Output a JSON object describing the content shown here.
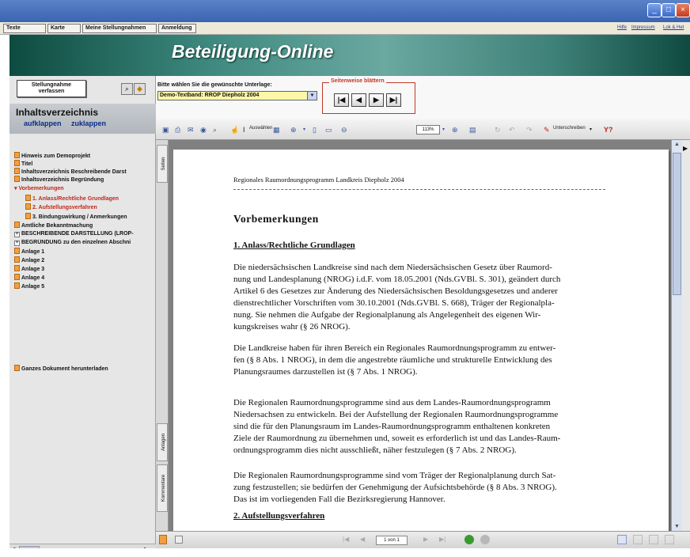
{
  "window_controls": [
    "_",
    "□",
    "×"
  ],
  "menu": {
    "items": [
      "Texte",
      "Karte",
      "Meine Stellungnahmen",
      "Anmeldung"
    ]
  },
  "top_links": [
    "Hilfe",
    "Impressum",
    "Lok & Het"
  ],
  "banner": {
    "title": "Beteiligung-Online"
  },
  "left": {
    "stellungnahme_button": "Stellungnahme\nverfassen",
    "icons": [
      "binoculars-icon",
      "arrow-icon"
    ],
    "inhalt_title": "Inhaltsverzeichnis",
    "aufklappen": "aufklappen",
    "zuklappen": "zuklappen",
    "tree": [
      {
        "label": "Hinweis zum Demoprojekt",
        "icon": "doc",
        "red": false
      },
      {
        "label": "Titel",
        "icon": "doc",
        "red": false
      },
      {
        "label": "Inhaltsverzeichnis Beschreibende Darst",
        "icon": "doc",
        "red": false
      },
      {
        "label": "Inhaltsverzeichnis Begründung",
        "icon": "doc",
        "red": false
      },
      {
        "label": "Vorbemerkungen",
        "icon": "bullet",
        "red": true
      },
      {
        "label": "1. Anlass/Rechtliche Grundlagen",
        "icon": "doc",
        "red": true,
        "indent": true
      },
      {
        "label": "2. Aufstellungsverfahren",
        "icon": "doc",
        "red": true,
        "indent": true
      },
      {
        "label": "3. Bindungswirkung / Anmerkungen",
        "icon": "doc",
        "red": false,
        "indent": true
      },
      {
        "label": "Amtliche Bekanntmachung",
        "icon": "doc",
        "red": false
      },
      {
        "label": "BESCHREIBENDE DARSTELLUNG (LROP-",
        "icon": "plus",
        "red": false
      },
      {
        "label": "BEGRÜNDUNG zu den einzelnen Abschni",
        "icon": "plus",
        "red": false
      },
      {
        "label": "Anlage 1",
        "icon": "doc",
        "red": false
      },
      {
        "label": "Anlage 2",
        "icon": "doc",
        "red": false
      },
      {
        "label": "Anlage 3",
        "icon": "doc",
        "red": false
      },
      {
        "label": "Anlage 4",
        "icon": "doc",
        "red": false
      },
      {
        "label": "Anlage 5",
        "icon": "doc",
        "red": false
      }
    ],
    "download": "Ganzes Dokument herunterladen"
  },
  "selector": {
    "label": "Bitte wählen Sie die gewünschte Unterlage:",
    "value": "Demo-Textband: RROP Diepholz 2004",
    "page_nav_label": "Seitenweise blättern",
    "nav_buttons": [
      "|◀",
      "◀",
      "▶",
      "▶|"
    ]
  },
  "pdf_toolbar": {
    "select_label": "Auswählen",
    "zoom": "113%",
    "sign_label": "Unterschreiben"
  },
  "side_tabs": [
    "Seiten",
    "Anlagen",
    "Kommentare"
  ],
  "document": {
    "header": "Regionales Raumordnungsprogramm Landkreis Diepholz 2004",
    "heading": "Vorbemerkungen",
    "section1": "1. Anlass/Rechtliche Grundlagen",
    "p1": [
      "Die niedersächsischen Landkreise sind nach dem Niedersächsischen Gesetz über Raumord-",
      "nung und Landesplanung (NROG) i.d.F. vom 18.05.2001 (Nds.GVBl. S. 301), geändert durch",
      "Artikel 6 des Gesetzes zur Änderung des Niedersächsischen Besoldungsgesetzes und anderer",
      "dienstrechtlicher Vorschriften vom 30.10.2001 (Nds.GVBl. S. 668), Träger der Regionalpla-",
      "nung. Sie nehmen die Aufgabe der Regionalplanung als Angelegenheit des eigenen Wir-",
      "kungskreises wahr (§ 26 NROG)."
    ],
    "p2": [
      "Die Landkreise haben für ihren Bereich ein Regionales Raumordnungsprogramm zu entwer-",
      "fen (§ 8 Abs. 1 NROG), in dem die angestrebte räumliche und strukturelle Entwicklung des",
      "Planungsraumes darzustellen ist (§ 7 Abs. 1 NROG)."
    ],
    "p3": [
      "Die Regionalen Raumordnungsprogramme sind aus dem Landes-Raumordnungsprogramm",
      "Niedersachsen zu entwickeln. Bei der Aufstellung der Regionalen Raumordnungsprogramme",
      "sind die für den Planungsraum im Landes-Raumordnungsprogramm enthaltenen konkreten",
      "Ziele der Raumordnung zu übernehmen und, soweit es erforderlich ist  und das Landes-Raum-",
      "ordnungsprogramm dies nicht ausschließt, näher festzulegen (§ 7 Abs. 2 NROG)."
    ],
    "p4": [
      "Die Regionalen Raumordnungsprogramme sind vom Träger der Regionalplanung durch Sat-",
      "zung festzustellen; sie bedürfen der Genehmigung der Aufsichtsbehörde (§ 8 Abs. 3 NROG).",
      "Das ist im vorliegenden Fall die Bezirksregierung Hannover."
    ],
    "section2": "2. Aufstellungsverfahren"
  },
  "status": {
    "page_indicator": "1 von 1"
  }
}
